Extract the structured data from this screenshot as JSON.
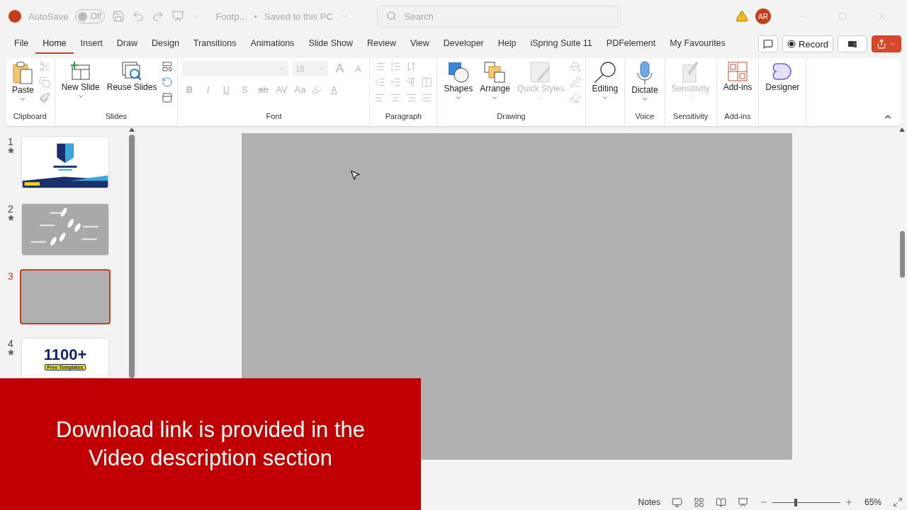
{
  "title_bar": {
    "autosave_label": "AutoSave",
    "autosave": {
      "on": false,
      "label": "Off"
    },
    "file_name": "Footp...",
    "separator": "•",
    "save_status": "Saved to this PC",
    "search": {
      "placeholder": "Search"
    },
    "avatar": "AR"
  },
  "tabs": [
    {
      "label": "File",
      "selected": false
    },
    {
      "label": "Home",
      "selected": true
    },
    {
      "label": "Insert",
      "selected": false
    },
    {
      "label": "Draw",
      "selected": false
    },
    {
      "label": "Design",
      "selected": false
    },
    {
      "label": "Transitions",
      "selected": false
    },
    {
      "label": "Animations",
      "selected": false
    },
    {
      "label": "Slide Show",
      "selected": false
    },
    {
      "label": "Review",
      "selected": false
    },
    {
      "label": "View",
      "selected": false
    },
    {
      "label": "Developer",
      "selected": false
    },
    {
      "label": "Help",
      "selected": false
    },
    {
      "label": "iSpring Suite 11",
      "selected": false
    },
    {
      "label": "PDFelement",
      "selected": false
    },
    {
      "label": "My Favourites",
      "selected": false
    }
  ],
  "record_button": "Record",
  "ribbon": [
    {
      "kind": "clipboard",
      "label": "Clipboard",
      "buttons": [
        {
          "label": "Paste",
          "disabled": false
        }
      ]
    },
    {
      "kind": "slides",
      "label": "Slides",
      "buttons": [
        {
          "label": "New Slide",
          "disabled": false
        },
        {
          "label": "Reuse Slides",
          "disabled": false
        }
      ]
    },
    {
      "kind": "font",
      "label": "Font",
      "font_size": "18",
      "disabled": true,
      "letters": [
        {
          "text": "A",
          "kind": "grow"
        },
        {
          "text": "A",
          "kind": "shrink"
        },
        {
          "text": "B",
          "kind": "bold"
        },
        {
          "text": "I",
          "kind": "italic"
        },
        {
          "text": "U",
          "kind": "underline"
        },
        {
          "text": "S",
          "kind": "shadow"
        },
        {
          "text": "ab",
          "kind": "strike"
        },
        {
          "text": "AV",
          "kind": "spacing"
        },
        {
          "text": "Aa",
          "kind": "case"
        },
        {
          "text": "A",
          "kind": "color"
        }
      ]
    },
    {
      "kind": "paragraph",
      "label": "Paragraph",
      "disabled": true
    },
    {
      "kind": "drawing",
      "label": "Drawing",
      "buttons": [
        {
          "label": "Shapes",
          "disabled": false
        },
        {
          "label": "Arrange",
          "disabled": false
        },
        {
          "label": "Quick Styles",
          "disabled": true
        }
      ]
    },
    {
      "kind": "editing",
      "buttons": [
        {
          "label": "Editing",
          "disabled": false
        }
      ]
    },
    {
      "kind": "voice",
      "label": "Voice",
      "buttons": [
        {
          "label": "Dictate",
          "disabled": false
        }
      ]
    },
    {
      "kind": "sensitivity",
      "label": "Sensitivity",
      "buttons": [
        {
          "label": "Sensitivity",
          "disabled": true
        }
      ]
    },
    {
      "kind": "addins",
      "label": "Add-ins",
      "buttons": [
        {
          "label": "Add-ins",
          "disabled": false
        }
      ]
    },
    {
      "kind": "designer",
      "buttons": [
        {
          "label": "Designer",
          "disabled": false
        }
      ]
    }
  ],
  "slides": [
    {
      "number": "1",
      "kind": "title",
      "starred": true,
      "selected": false
    },
    {
      "number": "2",
      "kind": "footprints",
      "starred": true,
      "selected": false
    },
    {
      "number": "3",
      "kind": "blank",
      "starred": false,
      "selected": true
    },
    {
      "number": "4",
      "kind": "promo",
      "starred": true,
      "selected": false,
      "headline": "1100+",
      "tag": "Free Templates"
    }
  ],
  "status_bar": {
    "notes": "Notes",
    "zoom": {
      "level": 0.32,
      "reading": "65%"
    }
  },
  "banner": "Download link is provided in the Video description section"
}
